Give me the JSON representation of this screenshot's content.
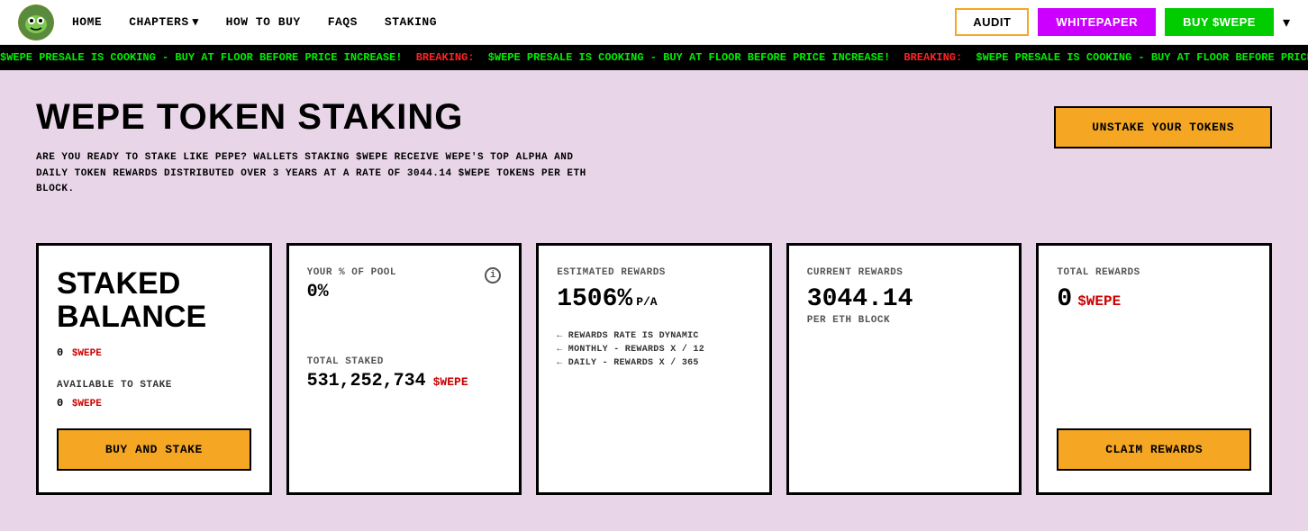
{
  "nav": {
    "links": [
      {
        "label": "HOME",
        "id": "home"
      },
      {
        "label": "CHAPTERS",
        "id": "chapters",
        "hasChevron": true
      },
      {
        "label": "HOW TO BUY",
        "id": "how-to-buy"
      },
      {
        "label": "FAQS",
        "id": "faqs"
      },
      {
        "label": "STAKING",
        "id": "staking"
      }
    ],
    "audit_label": "AUDIT",
    "whitepaper_label": "WHITEPAPER",
    "buy_label": "BUY $WEPE"
  },
  "ticker": {
    "text": "$WEPE PRESALE IS COOKING - BUY AT FLOOR BEFORE PRICE INCREASE!",
    "breaking": "BREAKING:"
  },
  "page": {
    "title": "WEPE TOKEN STAKING",
    "subtitle": "ARE YOU READY TO STAKE LIKE PEPE? WALLETS STAKING $WEPE RECEIVE WEPE'S TOP ALPHA AND DAILY TOKEN REWARDS DISTRIBUTED OVER 3 YEARS AT A RATE OF 3044.14 $WEPE TOKENS PER ETH BLOCK.",
    "unstake_label": "UNSTAKE YOUR TOKENS"
  },
  "cards": {
    "staked_balance": {
      "title_line1": "STAKED",
      "title_line2": "BALANCE",
      "balance_value": "0",
      "balance_currency": "$WEPE",
      "available_label": "AVAILABLE TO STAKE",
      "available_value": "0",
      "available_currency": "$WEPE",
      "buy_stake_label": "BUY AND STAKE"
    },
    "pool": {
      "your_pool_label": "YOUR % OF POOL",
      "pool_value": "0%",
      "total_staked_label": "TOTAL STAKED",
      "total_staked_value": "531,252,734",
      "total_staked_currency": "$WEPE"
    },
    "estimated": {
      "label": "ESTIMATED REWARDS",
      "value": "1506%",
      "suffix": "P/A",
      "notes": [
        "REWARDS RATE IS DYNAMIC",
        "MONTHLY - REWARDS X / 12",
        "DAILY - REWARDS X / 365"
      ]
    },
    "current": {
      "label": "CURRENT REWARDS",
      "value": "3044.14",
      "per_eth_label": "PER ETH BLOCK"
    },
    "total": {
      "label": "TOTAL REWARDS",
      "value": "0",
      "currency": "$WEPE",
      "claim_label": "CLAIM REWARDS"
    }
  }
}
